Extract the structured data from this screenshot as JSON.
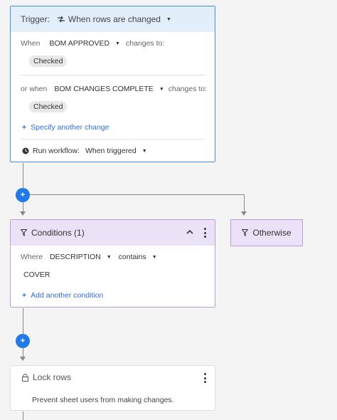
{
  "trigger": {
    "label": "Trigger:",
    "type": "When rows are changed",
    "when_label": "When",
    "when_field": "BOM APPROVED",
    "changes_to_1": "changes to:",
    "when_value": "Checked",
    "or_when_label": "or when",
    "or_when_field": "BOM CHANGES COMPLETE",
    "changes_to_2": "changes to:",
    "or_when_value": "Checked",
    "specify_link": "Specify another change",
    "run_label": "Run workflow:",
    "run_value": "When triggered"
  },
  "conditions": {
    "title": "Conditions (1)",
    "where_label": "Where",
    "field": "DESCRIPTION",
    "operator": "contains",
    "value": "COVER",
    "add_link": "Add another condition"
  },
  "otherwise": {
    "label": "Otherwise"
  },
  "lock": {
    "title": "Lock rows",
    "description": "Prevent sheet users from making changes."
  },
  "icons": {
    "trigger_type": "refresh-icon",
    "clock": "clock-icon",
    "filter": "filter-icon",
    "lock": "lock-icon",
    "plus": "plus-icon",
    "kebab": "more-vertical-icon",
    "collapse": "chevron-up-icon"
  },
  "colors": {
    "trigger_accent": "#4a8fd8",
    "condition_accent": "#b99fd6",
    "add_button": "#2378e8",
    "link": "#2f6fd1"
  }
}
